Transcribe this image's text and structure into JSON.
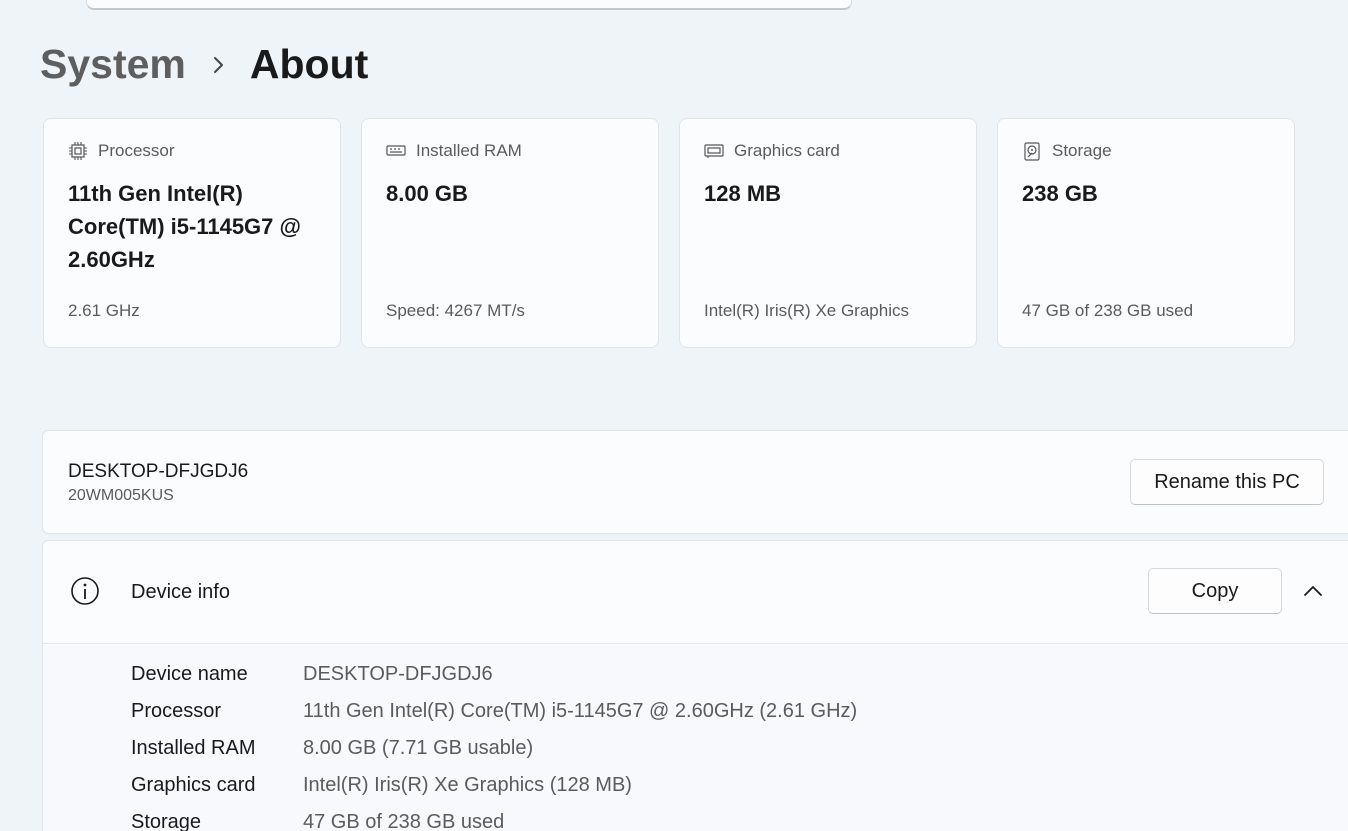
{
  "breadcrumb": {
    "parent": "System",
    "current": "About"
  },
  "cards": [
    {
      "icon": "processor-chip-icon",
      "title": "Processor",
      "value": "11th Gen Intel(R) Core(TM) i5-1145G7 @ 2.60GHz",
      "sub": "2.61 GHz"
    },
    {
      "icon": "ram-module-icon",
      "title": "Installed RAM",
      "value": "8.00 GB",
      "sub": "Speed: 4267 MT/s"
    },
    {
      "icon": "graphics-card-icon",
      "title": "Graphics card",
      "value": "128 MB",
      "sub": "Intel(R) Iris(R) Xe Graphics"
    },
    {
      "icon": "storage-drive-icon",
      "title": "Storage",
      "value": "238 GB",
      "sub": "47 GB of 238 GB used"
    }
  ],
  "pc": {
    "name": "DESKTOP-DFJGDJ6",
    "model": "20WM005KUS",
    "rename_label": "Rename this PC"
  },
  "device_info": {
    "title": "Device info",
    "copy_label": "Copy",
    "rows": [
      {
        "label": "Device name",
        "value": "DESKTOP-DFJGDJ6"
      },
      {
        "label": "Processor",
        "value": "11th Gen Intel(R) Core(TM) i5-1145G7 @ 2.60GHz (2.61 GHz)"
      },
      {
        "label": "Installed RAM",
        "value": "8.00 GB (7.71 GB usable)"
      },
      {
        "label": "Graphics card",
        "value": "Intel(R) Iris(R) Xe Graphics (128 MB)"
      },
      {
        "label": "Storage",
        "value": "47 GB of 238 GB used"
      }
    ]
  },
  "colors": {
    "background": "#eff4f9",
    "card": "#fbfcfe",
    "text_primary": "#1a1a1a",
    "text_secondary": "#5b5b5b"
  }
}
